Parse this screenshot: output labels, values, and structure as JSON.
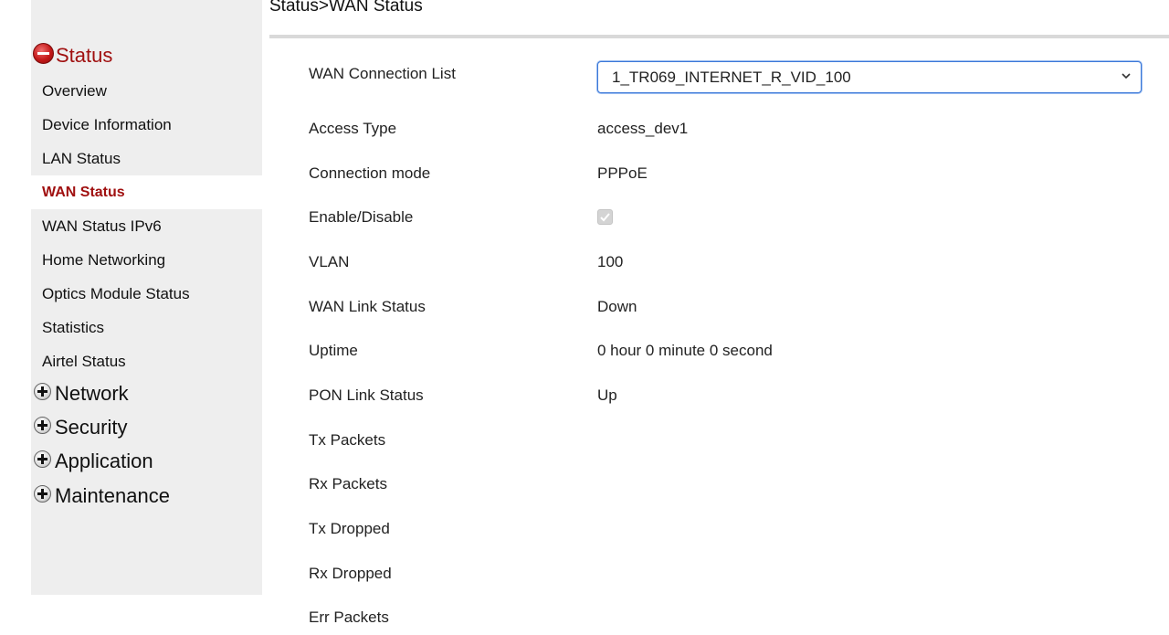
{
  "breadcrumb": "Status>WAN Status",
  "sidebar": {
    "groups": [
      {
        "label": "Status",
        "icon": "minus-circle-icon",
        "expanded": true
      },
      {
        "label": "Network",
        "icon": "plus-circle-icon",
        "expanded": false
      },
      {
        "label": "Security",
        "icon": "plus-circle-icon",
        "expanded": false
      },
      {
        "label": "Application",
        "icon": "plus-circle-icon",
        "expanded": false
      },
      {
        "label": "Maintenance",
        "icon": "plus-circle-icon",
        "expanded": false
      }
    ],
    "status_items": [
      {
        "label": "Overview"
      },
      {
        "label": "Device Information"
      },
      {
        "label": "LAN Status"
      },
      {
        "label": "WAN Status",
        "active": true
      },
      {
        "label": "WAN Status IPv6"
      },
      {
        "label": "Home Networking"
      },
      {
        "label": "Optics Module Status"
      },
      {
        "label": "Statistics"
      },
      {
        "label": "Airtel Status"
      }
    ]
  },
  "form": {
    "wan_connection_list": {
      "label": "WAN Connection List",
      "selected": "1_TR069_INTERNET_R_VID_100"
    },
    "rows": [
      {
        "label": "Access Type",
        "value": "access_dev1"
      },
      {
        "label": "Connection mode",
        "value": "PPPoE"
      },
      {
        "label": "Enable/Disable",
        "checked": true,
        "disabled": true
      },
      {
        "label": "VLAN",
        "value": "100"
      },
      {
        "label": "WAN Link Status",
        "value": "Down"
      },
      {
        "label": "Uptime",
        "value": "0 hour 0 minute 0 second"
      },
      {
        "label": "PON Link Status",
        "value": "Up"
      },
      {
        "label": "Tx Packets",
        "value": ""
      },
      {
        "label": "Rx Packets",
        "value": ""
      },
      {
        "label": "Tx Dropped",
        "value": ""
      },
      {
        "label": "Rx Dropped",
        "value": ""
      },
      {
        "label": "Err Packets",
        "value": ""
      }
    ]
  },
  "colors": {
    "accent": "#a01010",
    "sidebar_bg": "#eeeeee",
    "select_border": "#3b78d8"
  }
}
